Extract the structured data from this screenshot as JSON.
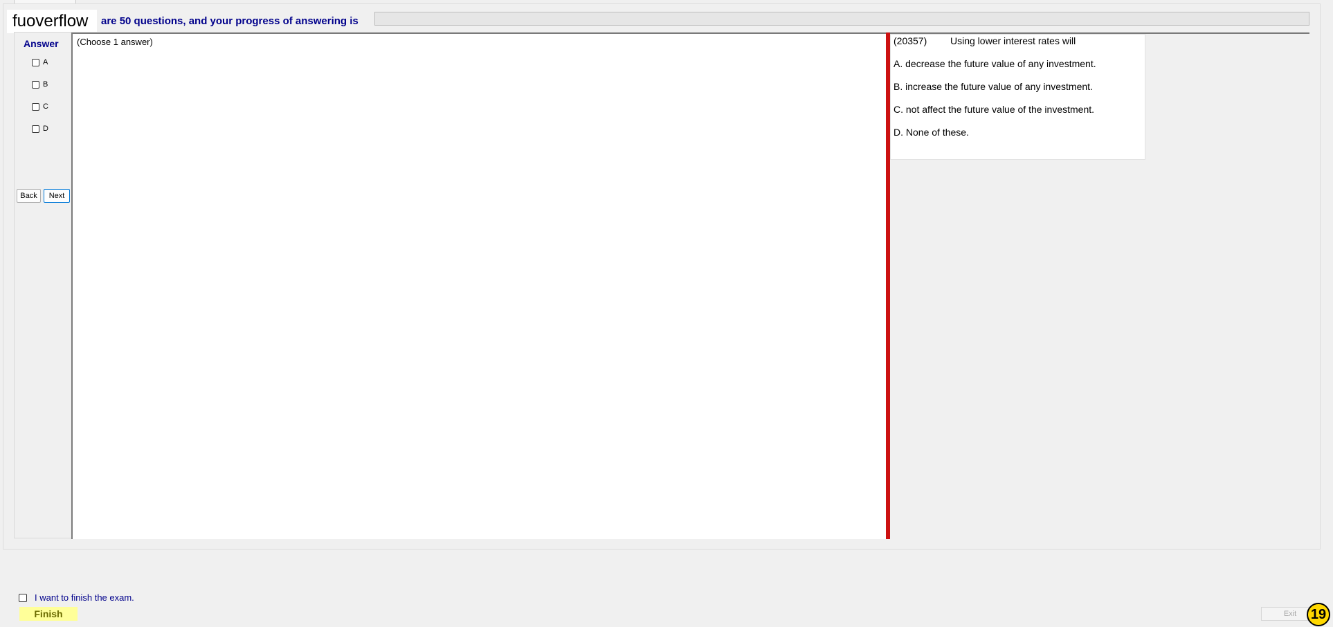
{
  "brand": {
    "name": "fuoverflow"
  },
  "header": {
    "progress_text": "are 50 questions, and your progress of answering is",
    "progress_fraction": 0
  },
  "answer_panel": {
    "title": "Answer",
    "options": [
      "A",
      "B",
      "C",
      "D"
    ],
    "back_label": "Back",
    "next_label": "Next"
  },
  "work_area": {
    "instruction": "(Choose 1 answer)"
  },
  "question": {
    "id": "(20357)",
    "text": "Using lower interest rates will",
    "choices": [
      "A.  decrease the future value of any investment.",
      "B.  increase the future value of any investment.",
      "C.  not affect the future value of the investment.",
      "D.  None of these."
    ]
  },
  "footer": {
    "finish_checkbox_label": "I want to finish the exam.",
    "finish_label": "Finish",
    "exit_label": "Exit",
    "badge_number": "19"
  },
  "colors": {
    "header_text": "#00008b",
    "divider_red": "#cc1111",
    "finish_bg": "#ffff99",
    "badge_bg": "#ffd800"
  }
}
